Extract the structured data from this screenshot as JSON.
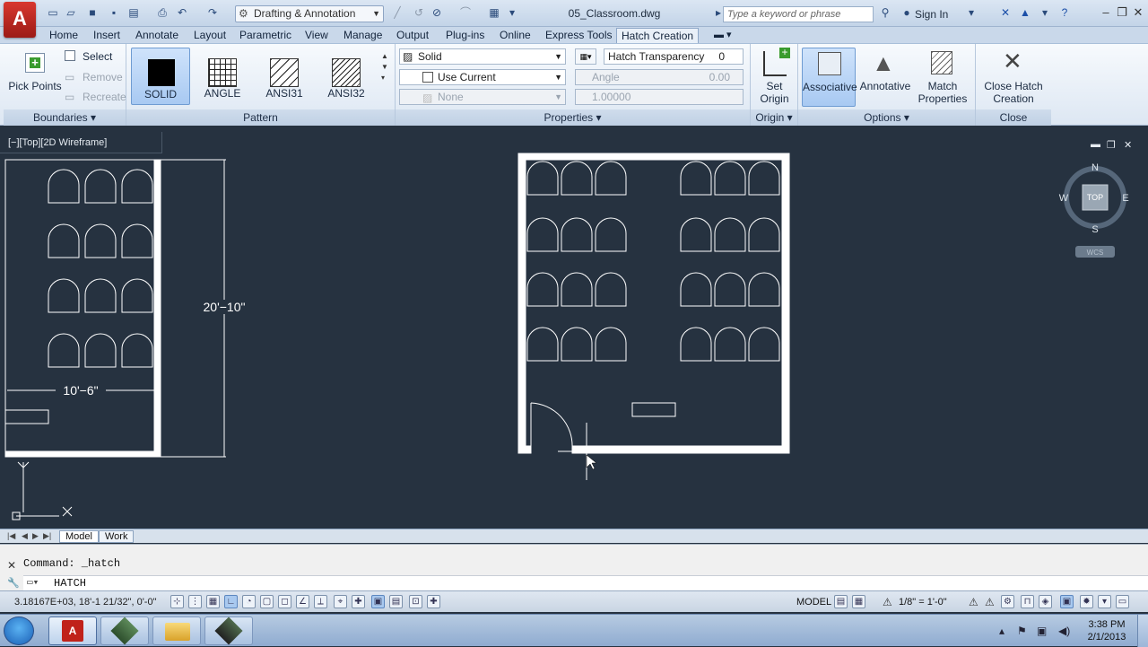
{
  "window": {
    "document_title": "05_Classroom.dwg",
    "workspace": "Drafting & Annotation",
    "search_placeholder": "Type a keyword or phrase",
    "sign_in": "Sign In"
  },
  "tabs": [
    {
      "label": "Home"
    },
    {
      "label": "Insert"
    },
    {
      "label": "Annotate"
    },
    {
      "label": "Layout"
    },
    {
      "label": "Parametric"
    },
    {
      "label": "View"
    },
    {
      "label": "Manage"
    },
    {
      "label": "Output"
    },
    {
      "label": "Plug-ins"
    },
    {
      "label": "Online"
    },
    {
      "label": "Express Tools"
    },
    {
      "label": "Hatch Creation"
    }
  ],
  "ribbon": {
    "boundaries": {
      "title": "Boundaries",
      "pick_points": "Pick Points",
      "select": "Select",
      "remove": "Remove",
      "recreate": "Recreate"
    },
    "pattern": {
      "title": "Pattern",
      "items": [
        {
          "label": "SOLID"
        },
        {
          "label": "ANGLE"
        },
        {
          "label": "ANSI31"
        },
        {
          "label": "ANSI32"
        }
      ]
    },
    "properties": {
      "title": "Properties",
      "hatch_type": "Solid",
      "color": "Use Current",
      "background": "None",
      "transparency_label": "Hatch Transparency",
      "transparency_value": "0",
      "angle_label": "Angle",
      "angle_value": "0.00",
      "scale_value": "1.00000"
    },
    "origin": {
      "title": "Origin",
      "set_origin": "Set Origin"
    },
    "options": {
      "title": "Options",
      "associative": "Associative",
      "annotative": "Annotative",
      "match_properties": "Match Properties"
    },
    "close": {
      "title": "Close",
      "close_hatch": "Close Hatch Creation"
    }
  },
  "viewport": {
    "label": "[−][Top][2D Wireframe]",
    "dimension_vertical": "20'−10\"",
    "dimension_horizontal": "10'−6\"",
    "viewcube": {
      "top": "TOP",
      "n": "N",
      "s": "S",
      "e": "E",
      "w": "W",
      "wcs": "WCS"
    }
  },
  "layout_tabs": [
    {
      "label": "Model"
    },
    {
      "label": "Work"
    }
  ],
  "command": {
    "history": "Command: _hatch",
    "current": "HATCH"
  },
  "status": {
    "coordinates": "3.18167E+03, 18'-1 21/32\", 0'-0\"",
    "model": "MODEL",
    "scale": "1/8\" = 1'-0\""
  },
  "taskbar": {
    "time": "3:38 PM",
    "date": "2/1/2013"
  }
}
